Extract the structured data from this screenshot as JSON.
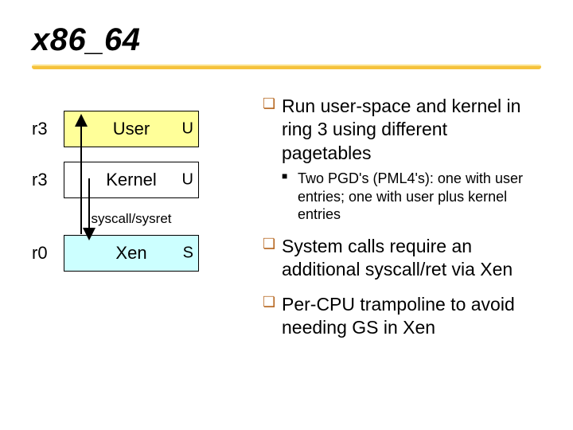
{
  "title": "x86_64",
  "diagram": {
    "rows": [
      {
        "ring": "r3",
        "label": "User",
        "cell": "U",
        "cls": "user"
      },
      {
        "ring": "r3",
        "label": "Kernel",
        "cell": "U",
        "cls": "kern"
      },
      {
        "ring": "r0",
        "label": "Xen",
        "cell": "S",
        "cls": "xen"
      }
    ],
    "between_label": "syscall/sysret"
  },
  "bullets": [
    {
      "text": "Run user-space and kernel in ring 3 using different pagetables",
      "sub": [
        "Two PGD's (PML4's): one with user entries; one with user plus kernel entries"
      ]
    },
    {
      "text": "System calls require an additional syscall/ret via Xen",
      "sub": []
    },
    {
      "text": "Per-CPU trampoline to avoid needing GS in Xen",
      "sub": []
    }
  ]
}
